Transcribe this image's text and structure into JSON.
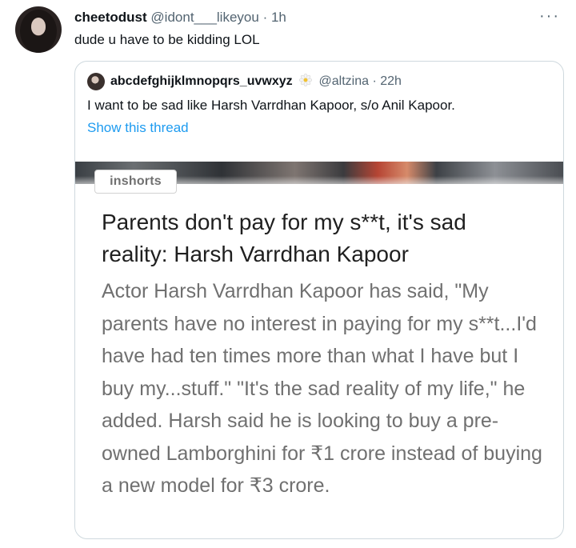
{
  "tweet": {
    "author_name": "cheetodust",
    "author_handle": "@idont___likeyou",
    "separator": "·",
    "time": "1h",
    "more_glyph": "···",
    "text": "dude u have to be kidding LOL"
  },
  "quote": {
    "author_name": "abcdefghijklmnopqrs_uvwxyz",
    "author_emoji_icon": "daisy-icon",
    "author_handle": "@altzina",
    "separator": "·",
    "time": "22h",
    "text": "I want to be sad like Harsh Varrdhan Kapoor, s/o Anil Kapoor.",
    "show_thread": "Show this thread",
    "card": {
      "source_badge": "inshorts",
      "title": "Parents don't pay for my s**t, it's sad reality: Harsh Varrdhan Kapoor",
      "body": "Actor Harsh Varrdhan Kapoor has said, \"My parents have no interest in paying for my s**t...I'd have had ten times more than what I have but I buy my...stuff.\" \"It's the sad reality of my life,\" he added. Harsh said he is looking to buy a pre-owned Lamborghini for ₹1 crore instead of buying a new model for ₹3 crore."
    }
  },
  "colors": {
    "text_primary": "#0f1419",
    "text_secondary": "#536471",
    "link": "#1d9bf0",
    "border": "#cfd9de"
  }
}
